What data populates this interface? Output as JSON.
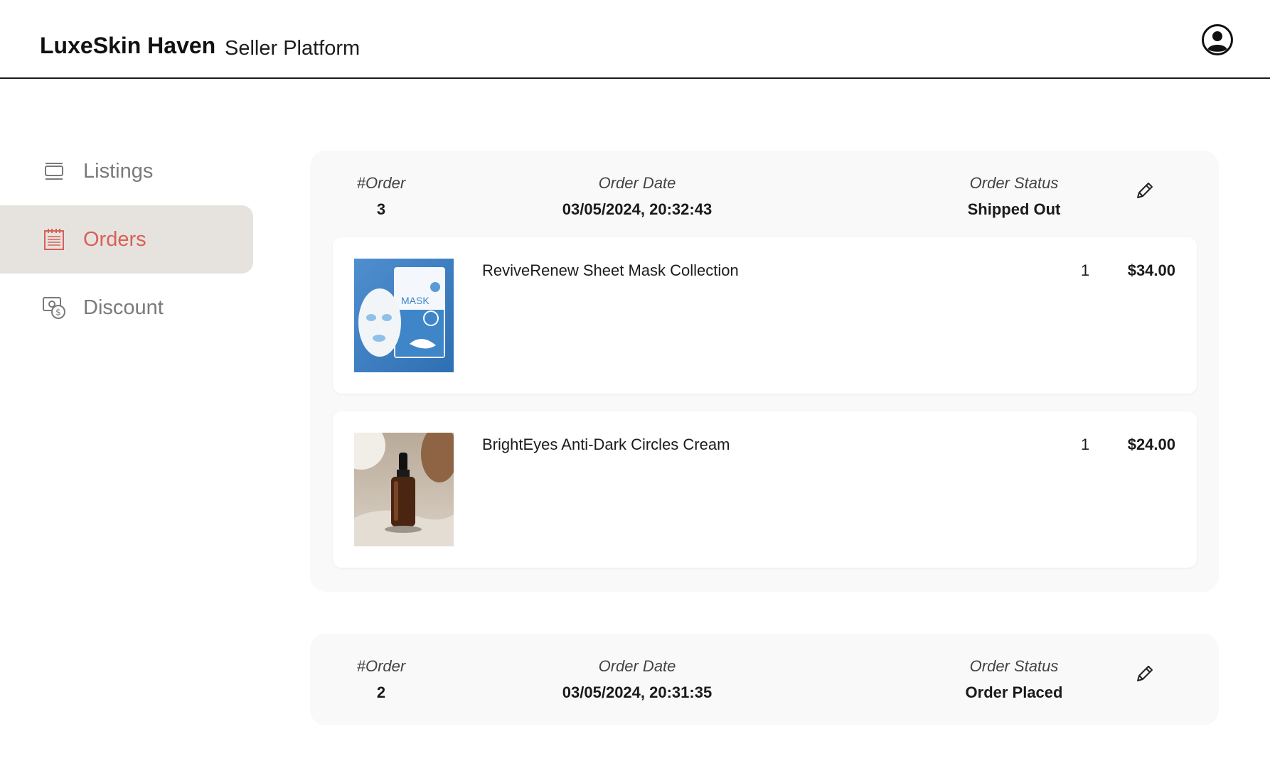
{
  "header": {
    "brand": "LuxeSkin Haven",
    "platform": "Seller Platform",
    "avatar_icon": "user-circle-icon"
  },
  "sidebar": {
    "items": [
      {
        "label": "Listings",
        "icon": "listings-icon",
        "active": false
      },
      {
        "label": "Orders",
        "icon": "orders-icon",
        "active": true
      },
      {
        "label": "Discount",
        "icon": "discount-icon",
        "active": false
      }
    ],
    "active_color": "#d95f59",
    "active_bg": "#e6e3de"
  },
  "orders": [
    {
      "order_label": "#Order",
      "order_number": "3",
      "date_label": "Order Date",
      "date": "03/05/2024, 20:32:43",
      "status_label": "Order Status",
      "status": "Shipped Out",
      "items": [
        {
          "name": "ReviveRenew Sheet Mask Collection",
          "qty": "1",
          "price": "$34.00",
          "image": "sheet-mask-product"
        },
        {
          "name": "BrightEyes Anti-Dark Circles Cream",
          "qty": "1",
          "price": "$24.00",
          "image": "dropper-bottle-product"
        }
      ]
    },
    {
      "order_label": "#Order",
      "order_number": "2",
      "date_label": "Order Date",
      "date": "03/05/2024, 20:31:35",
      "status_label": "Order Status",
      "status": "Order Placed",
      "items": []
    }
  ]
}
